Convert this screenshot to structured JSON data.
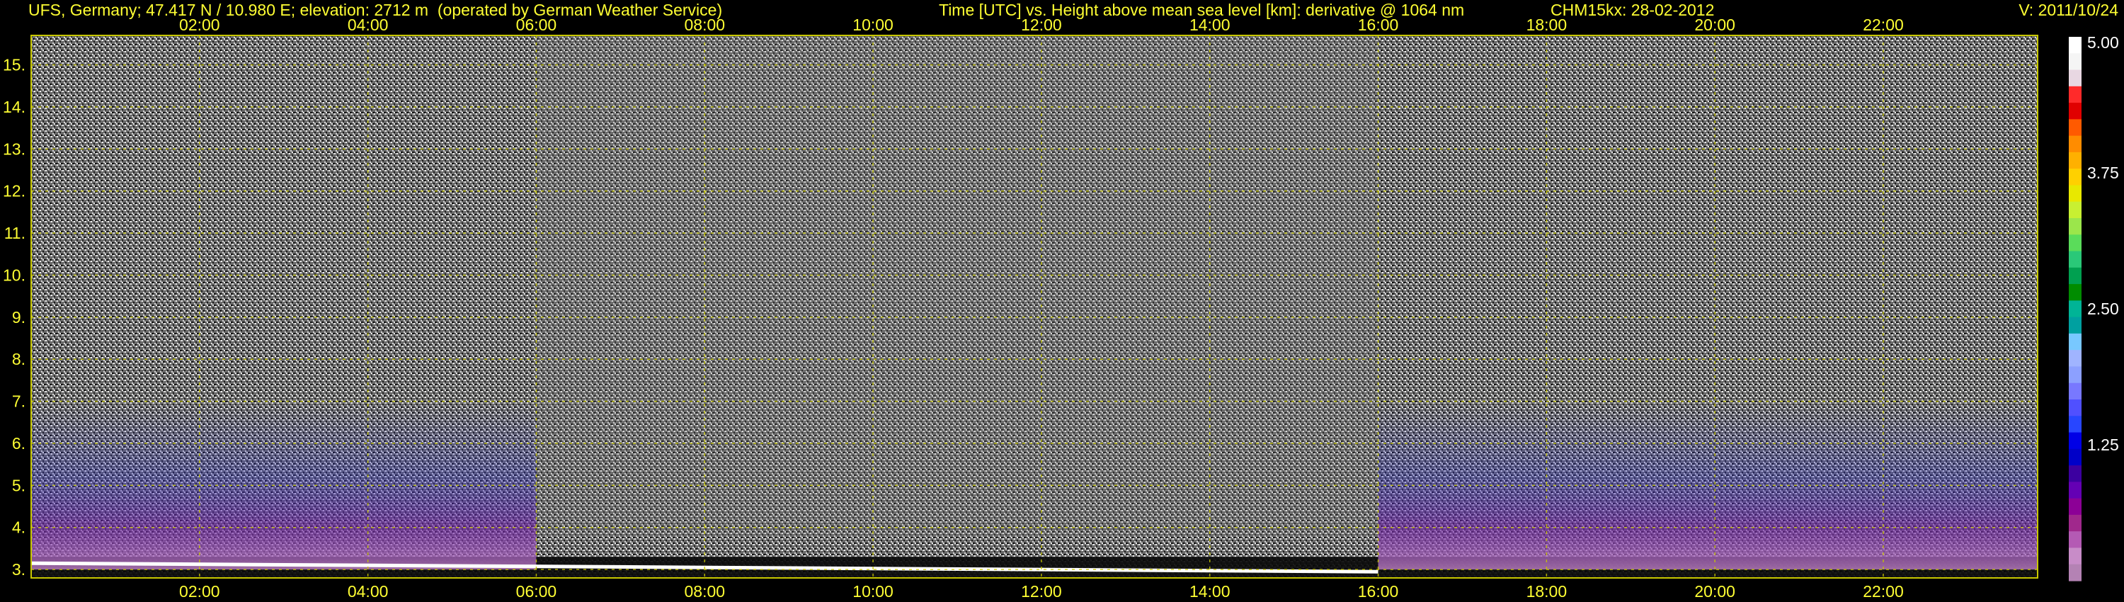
{
  "header": {
    "site_info": "UFS, Germany; 47.417 N / 10.980 E; elevation: 2712 m  (operated by German Weather Service)",
    "plot_description": "Time [UTC] vs. Height above mean sea level [km]: derivative @ 1064 nm",
    "device_date": "CHM15kx: 28-02-2012",
    "version": "V: 2011/10/24"
  },
  "colors": {
    "background": "#000000",
    "axis_text": "#ffff33",
    "grid": "#c8c800",
    "colorbar_text": "#ffffff"
  },
  "chart_data": {
    "type": "heatmap",
    "variable": "derivative @ 1064 nm",
    "x_unit": "Time [UTC]",
    "y_unit": "Height above mean sea level [km]",
    "xlim": [
      "00:00",
      "23:50"
    ],
    "ylim": [
      2.8,
      15.7
    ],
    "x_ticks": [
      "02:00",
      "04:00",
      "06:00",
      "08:00",
      "10:00",
      "12:00",
      "14:00",
      "16:00",
      "18:00",
      "20:00",
      "22:00"
    ],
    "y_ticks": [
      3,
      4,
      5,
      6,
      7,
      8,
      9,
      10,
      11,
      12,
      13,
      14,
      15
    ],
    "grid": true,
    "colorbar": {
      "min": 0,
      "max": 5.0,
      "labels": [
        "5.00",
        "3.75",
        "2.50",
        "1.25"
      ],
      "label_values": [
        5.0,
        3.75,
        2.5,
        1.25
      ],
      "colors": [
        "#ffffff",
        "#f5f5f5",
        "#e8d7e2",
        "#ff2a2a",
        "#e00000",
        "#ff5a00",
        "#ff8c00",
        "#ffb000",
        "#ffd000",
        "#e8e800",
        "#c8f032",
        "#9be64b",
        "#5adc5a",
        "#2ac878",
        "#00a050",
        "#008c00",
        "#00b496",
        "#00a0a0",
        "#78c8ff",
        "#a0b4ff",
        "#8ca0ff",
        "#7878ff",
        "#5050ff",
        "#2846ff",
        "#0000e6",
        "#0000c8",
        "#3c00a0",
        "#6400b4",
        "#8c0096",
        "#a0288c",
        "#b45ab4",
        "#c88cc8",
        "#b482b4"
      ]
    },
    "features": [
      {
        "name": "surface signal band",
        "time_range": [
          "00:00",
          "23:50"
        ],
        "height_km": [
          2.8,
          3.3
        ]
      },
      {
        "name": "elevated backscatter layer",
        "time_range": [
          "00:00",
          "06:00"
        ],
        "height_km": [
          3.0,
          7.0
        ]
      },
      {
        "name": "elevated backscatter layer",
        "time_range": [
          "16:00",
          "23:50"
        ],
        "height_km": [
          3.0,
          7.0
        ]
      },
      {
        "name": "daytime noise region",
        "time_range": [
          "06:00",
          "16:00"
        ],
        "height_km": [
          3.8,
          15.7
        ]
      }
    ]
  }
}
